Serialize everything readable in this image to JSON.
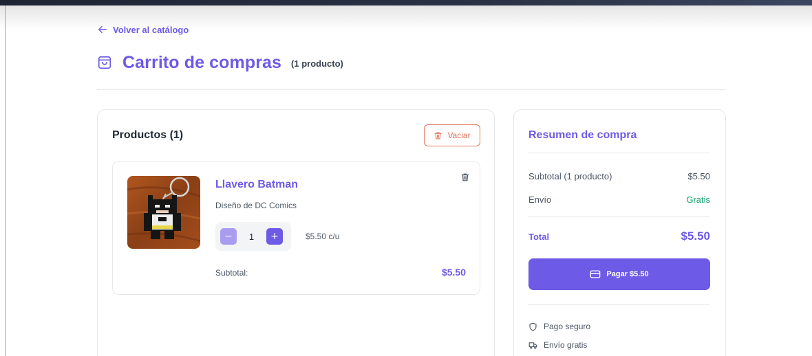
{
  "nav": {
    "back_label": "Volver al catálogo"
  },
  "header": {
    "title": "Carrito de compras",
    "count": "(1 producto)"
  },
  "products": {
    "title": "Productos (1)",
    "clear_label": "Vaciar",
    "items": [
      {
        "name": "Llavero Batman",
        "description": "Diseño de DC Comics",
        "quantity": "1",
        "unit_price": "$5.50 c/u",
        "subtotal_label": "Subtotal:",
        "subtotal_value": "$5.50"
      }
    ]
  },
  "summary": {
    "title": "Resumen de compra",
    "subtotal_label": "Subtotal (1 producto)",
    "subtotal_value": "$5.50",
    "shipping_label": "Envío",
    "shipping_value": "Gratis",
    "total_label": "Total",
    "total_value": "$5.50",
    "pay_label": "Pagar $5.50",
    "features": [
      "Pago seguro",
      "Envío gratis"
    ]
  },
  "colors": {
    "accent": "#6d5ae6",
    "accent_light": "#a99cf0",
    "danger": "#e2755b",
    "success": "#14a36b"
  }
}
